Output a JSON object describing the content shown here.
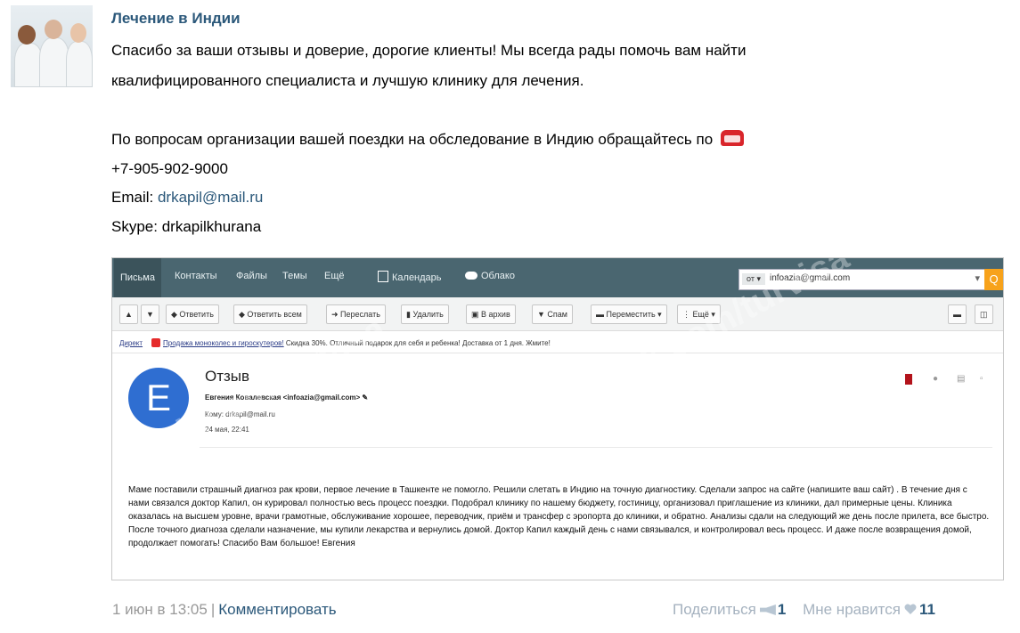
{
  "post": {
    "author": "Лечение в Индии",
    "line1": "Спасибо за ваши отзывы и доверие, дорогие клиенты! Мы всегда рады помочь вам найти",
    "line2": "квалифицированного специалиста и лучшую клинику для лечения.",
    "line3": "По вопросам организации вашей поездки на обследование в Индию обращайтесь по",
    "phone": "+7-905-902-9000",
    "email_label": "Email: ",
    "email": "drkapil@mail.ru",
    "skype_label": "Skype: ",
    "skype": "drkapilkhurana"
  },
  "screenshot": {
    "nav": [
      "Письма",
      "Контакты",
      "Файлы",
      "Темы",
      "Ещё",
      "Календарь",
      "Облако"
    ],
    "search": {
      "dropdown": "от ▾",
      "value": "infoazia@gmail.com",
      "chevron": "▾",
      "button": "Q"
    },
    "toolbar": [
      "▲",
      "▼",
      "◆ Ответить",
      "◆ Ответить всем",
      "➜ Переслать",
      "▮ Удалить",
      "▣ В архив",
      "▼ Спам",
      "▬ Переместить ▾",
      "⋮ Ещё ▾",
      "▬",
      "◫"
    ],
    "ad": {
      "prefix": "Директ",
      "link": "Продажа моноколес и гироскутеров!",
      "text": " Скидка 30%. Отличный подарок для себя и ребенка! Доставка от 1 дня. Жмите!"
    },
    "mail": {
      "avatar_letter": "Е",
      "subject": "Отзыв",
      "from": "Евгения Ковалевская <infoazia@gmail.com> ✎",
      "to": "Кому: drkapil@mail.ru",
      "date": "24 мая, 22:41",
      "icons": [
        "●",
        "▤",
        "▫"
      ],
      "body": "Маме поставили  страшный диагноз рак крови,  первое лечение в Ташкенте не помогло. Решили слетать в  Индию на точную диагностику. Сделали запрос на сайте (напишите ваш сайт) . В течение дня с нами связался доктор Капил,  он курировал полностью весь процесс поездки. Подобрал клинику по нашему бюджету, гостиницу, организовал приглашение из клиники,  дал примерные цены.  Клиника оказалась на высшем уровне,  врачи грамотные, обслуживание хорошее, переводчик, приём и трансфер с эропорта до клиники,  и обратно. Анализы сдали на следующий же день после прилета,  все быстро. После точного диагноза сделали  назначение, мы  купили лекарства и вернулись домой. Доктор Капил каждый день с нами связывался,  и контролировал весь процесс. И даже после возвращения домой, продолжает помогать! Спасибо Вам  большое!  Евгения"
    },
    "watermark": "vk.com/turvisa"
  },
  "footer": {
    "date": "1 июн в 13:05",
    "separator": "|",
    "comment": "Комментировать",
    "share_label": "Поделиться",
    "share_count": "1",
    "like_label": "Мне нравится",
    "like_count": "11"
  },
  "colors": {
    "link": "#2b587a",
    "mail_bar": "#4a6670",
    "search_button": "#f7a21b",
    "avatar_bg": "#2f6ed1"
  }
}
